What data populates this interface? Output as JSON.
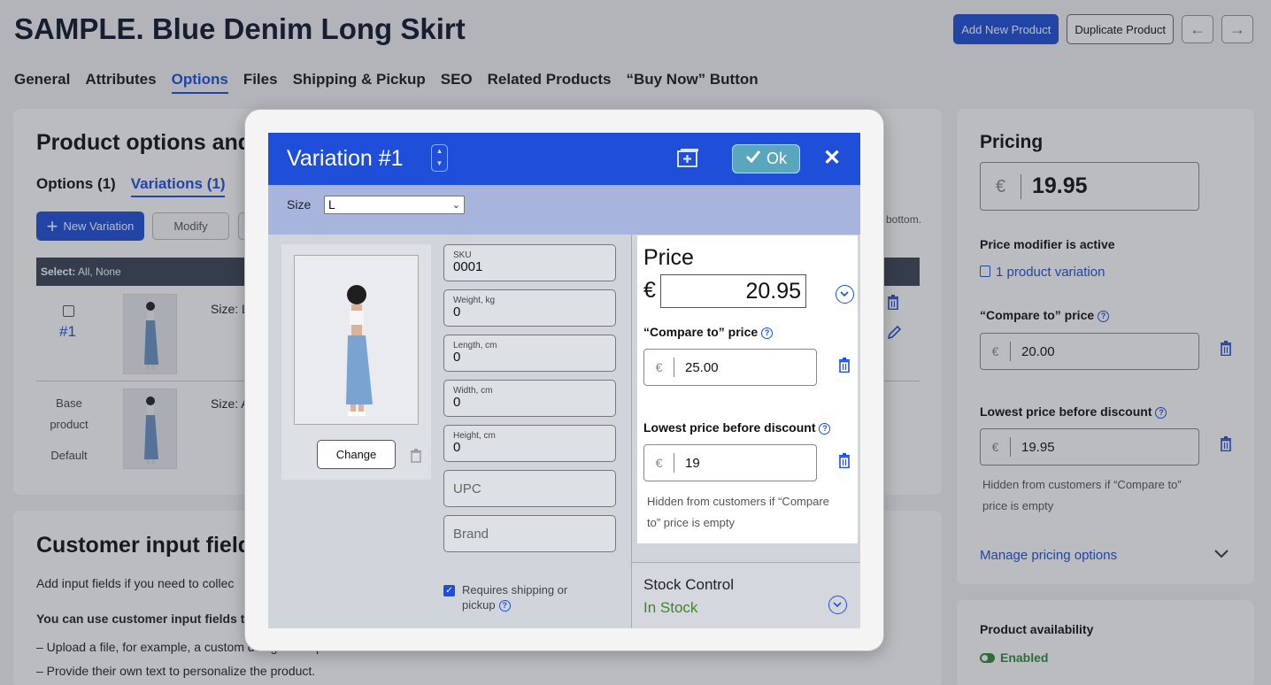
{
  "page": {
    "title": "SAMPLE. Blue Denim Long Skirt",
    "add_new_label": "Add New Product",
    "duplicate_label": "Duplicate Product",
    "prev_icon": "arrow-left-icon",
    "next_icon": "arrow-right-icon"
  },
  "tabs": [
    {
      "label": "General"
    },
    {
      "label": "Attributes"
    },
    {
      "label": "Options",
      "active": true
    },
    {
      "label": "Files"
    },
    {
      "label": "Shipping & Pickup"
    },
    {
      "label": "SEO"
    },
    {
      "label": "Related Products"
    },
    {
      "label": "“Buy Now” Button"
    }
  ],
  "options_card": {
    "title": "Product options and",
    "subtabs": [
      "Options (1)",
      "Variations (1)"
    ],
    "new_variation_label": "New Variation",
    "modify_label": "Modify",
    "select_label": "Select:",
    "select_options": "All, None",
    "hint": "bottom.",
    "rows": [
      {
        "number": "#1",
        "size": "Size: L"
      },
      {
        "base_lines": [
          "Base",
          "product",
          "Default"
        ],
        "size": "Size: A"
      }
    ]
  },
  "input_card": {
    "title": "Customer input fields",
    "intro": "Add input fields if you need to collec",
    "bold_line": "You can use customer input fields to",
    "bullets": [
      "–  Upload a file, for example, a custom design for a product.",
      "–  Provide their own text to personalize the product."
    ]
  },
  "pricing_card": {
    "title": "Pricing",
    "currency": "€",
    "price": "19.95",
    "modifier_label": "Price modifier is active",
    "variation_link": "1 product variation",
    "compare_label": "“Compare to” price",
    "compare_value": "20.00",
    "lowest_label": "Lowest price before discount",
    "lowest_value": "19.95",
    "hint": "Hidden from customers if “Compare to” price is empty",
    "manage_link": "Manage pricing options"
  },
  "availability_card": {
    "title": "Product availability",
    "status": "Enabled"
  },
  "modal": {
    "title": "Variation #1",
    "ok_label": "Ok",
    "size_label": "Size",
    "size_value": "L",
    "change_label": "Change",
    "fields": [
      {
        "label": "SKU",
        "value": "0001"
      },
      {
        "label": "Weight, kg",
        "value": "0"
      },
      {
        "label": "Length, cm",
        "value": "0"
      },
      {
        "label": "Width, cm",
        "value": "0"
      },
      {
        "label": "Height, cm",
        "value": "0"
      }
    ],
    "upc_placeholder": "UPC",
    "brand_placeholder": "Brand",
    "shipping_label": "Requires shipping or pickup",
    "price_title": "Price",
    "currency": "€",
    "price_value": "20.95",
    "compare_label": "“Compare to” price",
    "compare_value": "25.00",
    "lowest_label": "Lowest price before discount",
    "lowest_value": "19",
    "hint": "Hidden from customers if “Compare to” price is empty",
    "stock_title": "Stock Control",
    "stock_value": "In Stock"
  },
  "colors": {
    "accent": "#1f4fd8",
    "in_stock": "#3a8a1a",
    "enabled": "#2e8b3a"
  }
}
